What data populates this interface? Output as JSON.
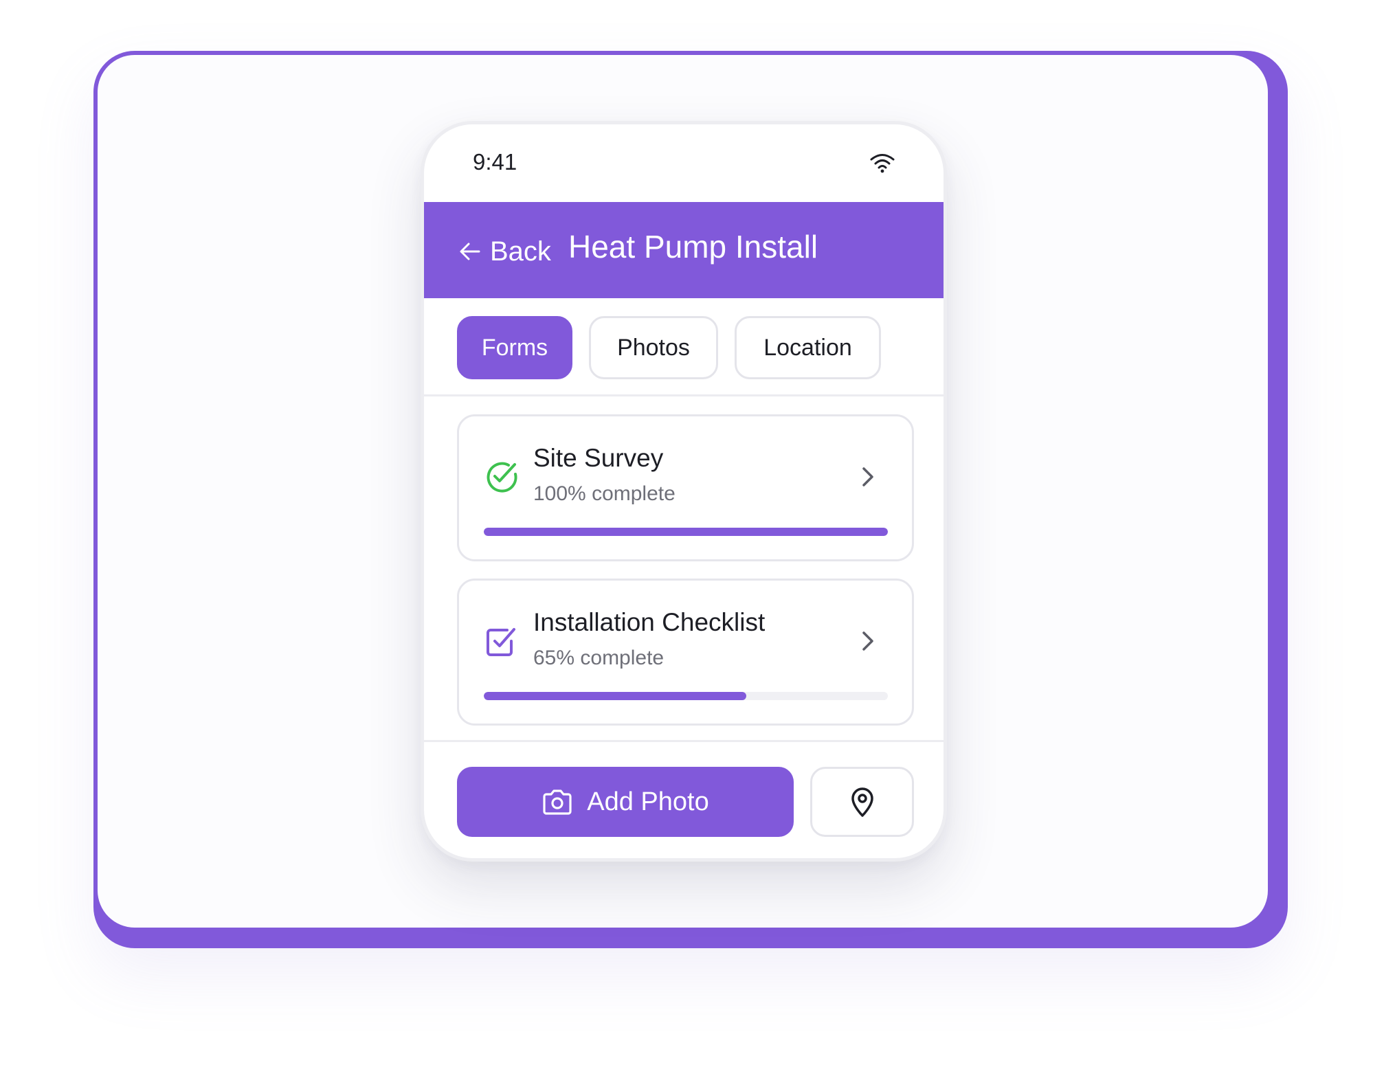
{
  "status_bar": {
    "time": "9:41",
    "signal_icon": "wifi-icon"
  },
  "header": {
    "back_label": "Back",
    "back_icon": "arrow-left-icon",
    "title": "Heat Pump Install",
    "color": "#8159da"
  },
  "tabs": [
    {
      "label": "Forms",
      "active": true
    },
    {
      "label": "Photos",
      "active": false
    },
    {
      "label": "Location",
      "active": false
    }
  ],
  "forms": [
    {
      "title": "Site Survey",
      "status": "100% complete",
      "progress": 1.0,
      "icon": "check-circle-icon",
      "icon_color": "#3ec14f"
    },
    {
      "title": "Installation Checklist",
      "status": "65% complete",
      "progress": 0.65,
      "icon": "checkbox-icon",
      "icon_color": "#8159da"
    }
  ],
  "actions": {
    "add_photo_label": "Add Photo",
    "add_photo_icon": "camera-icon",
    "location_icon": "map-pin-icon"
  },
  "colors": {
    "accent": "#8159da",
    "success": "#3ec14f",
    "text": "#1d1e25",
    "muted": "#6e6f78"
  }
}
